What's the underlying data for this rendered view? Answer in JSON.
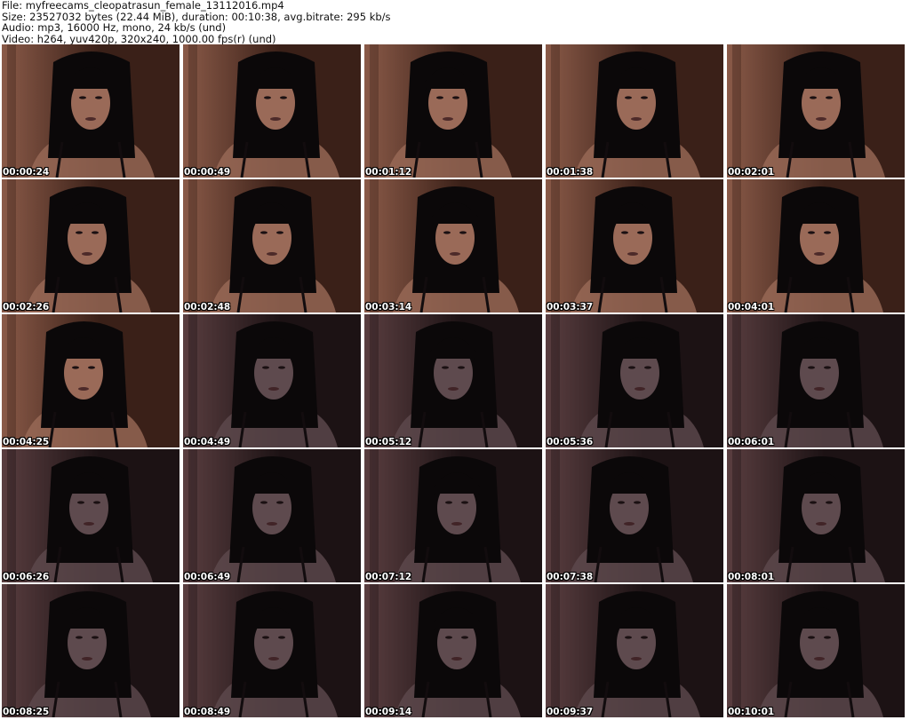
{
  "header": {
    "file_line": "File: myfreecams_cleopatrasun_female_13112016.mp4",
    "size_line": "Size: 23527032 bytes (22.44 MiB), duration: 00:10:38, avg.bitrate: 295 kb/s",
    "audio_line": "Audio: mp3, 16000 Hz, mono, 24 kb/s (und)",
    "video_line": "Video: h264, yuv420p, 320x240, 1000.00 fps(r) (und)"
  },
  "thumbnails": [
    {
      "time": "00:00:24",
      "tone": "warm"
    },
    {
      "time": "00:00:49",
      "tone": "warm"
    },
    {
      "time": "00:01:12",
      "tone": "warm"
    },
    {
      "time": "00:01:38",
      "tone": "warm"
    },
    {
      "time": "00:02:01",
      "tone": "warm"
    },
    {
      "time": "00:02:26",
      "tone": "warm"
    },
    {
      "time": "00:02:48",
      "tone": "warm"
    },
    {
      "time": "00:03:14",
      "tone": "warm"
    },
    {
      "time": "00:03:37",
      "tone": "warm"
    },
    {
      "time": "00:04:01",
      "tone": "warm"
    },
    {
      "time": "00:04:25",
      "tone": "warm"
    },
    {
      "time": "00:04:49",
      "tone": "dark"
    },
    {
      "time": "00:05:12",
      "tone": "dark"
    },
    {
      "time": "00:05:36",
      "tone": "dark"
    },
    {
      "time": "00:06:01",
      "tone": "dark"
    },
    {
      "time": "00:06:26",
      "tone": "dark"
    },
    {
      "time": "00:06:49",
      "tone": "dark"
    },
    {
      "time": "00:07:12",
      "tone": "dark"
    },
    {
      "time": "00:07:38",
      "tone": "dark"
    },
    {
      "time": "00:08:01",
      "tone": "dark"
    },
    {
      "time": "00:08:25",
      "tone": "dark"
    },
    {
      "time": "00:08:49",
      "tone": "dark"
    },
    {
      "time": "00:09:14",
      "tone": "dark"
    },
    {
      "time": "00:09:37",
      "tone": "dark"
    },
    {
      "time": "00:10:01",
      "tone": "dark"
    }
  ],
  "colors": {
    "warm_bg_light": "#8a5a48",
    "warm_bg_dark": "#3a2018",
    "dark_bg_light": "#5a3e40",
    "dark_bg_dark": "#1c1214",
    "hair": "#0b0809",
    "skin_warm": "#9a6a58",
    "skin_dark": "#5e4a4e"
  }
}
